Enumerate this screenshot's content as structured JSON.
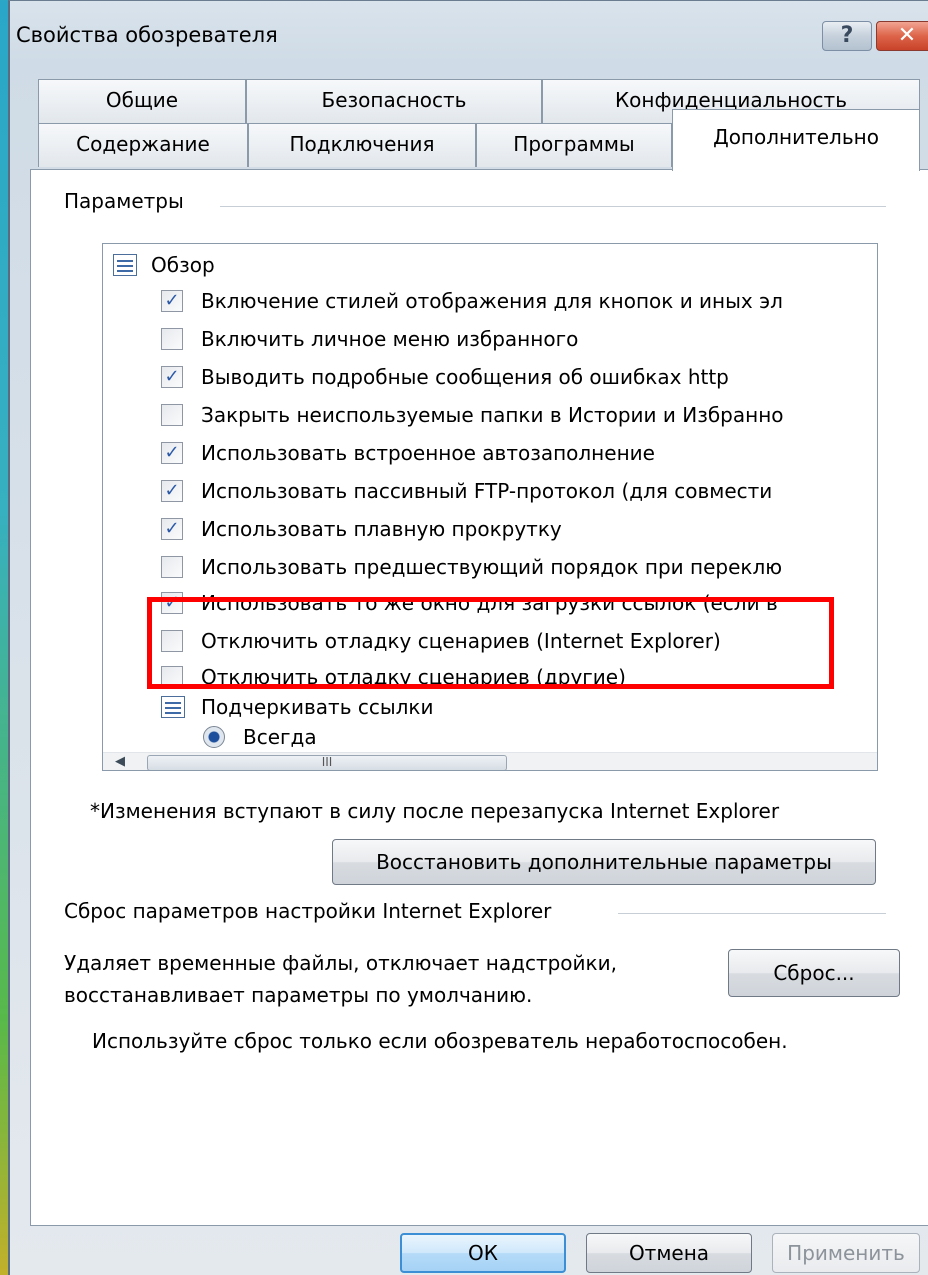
{
  "window": {
    "title": "Свойства обозревателя",
    "help_label": "?",
    "close_label": "✕"
  },
  "tabs": {
    "row1": [
      "Общие",
      "Безопасность",
      "Конфиденциальность"
    ],
    "row2": [
      "Содержание",
      "Подключения",
      "Программы",
      "Дополнительно"
    ],
    "active": "Дополнительно"
  },
  "settings": {
    "group_label": "Параметры",
    "items": [
      {
        "kind": "group",
        "label": "Обзор"
      },
      {
        "kind": "checkbox",
        "checked": true,
        "label": "Включение стилей отображения для кнопок и иных эл"
      },
      {
        "kind": "checkbox",
        "checked": false,
        "label": "Включить личное меню избранного"
      },
      {
        "kind": "checkbox",
        "checked": true,
        "label": "Выводить подробные сообщения об ошибках http"
      },
      {
        "kind": "checkbox",
        "checked": false,
        "label": "Закрыть неиспользуемые папки в Истории и Избранно"
      },
      {
        "kind": "checkbox",
        "checked": true,
        "label": "Использовать встроенное автозаполнение"
      },
      {
        "kind": "checkbox",
        "checked": true,
        "label": "Использовать пассивный FTP-протокол (для совмести"
      },
      {
        "kind": "checkbox",
        "checked": true,
        "label": "Использовать плавную прокрутку"
      },
      {
        "kind": "checkbox",
        "checked": false,
        "label": "Использовать предшествующий порядок при переклю"
      },
      {
        "kind": "checkbox",
        "checked": true,
        "label": "Использовать то же окно для загрузки ссылок (если в"
      },
      {
        "kind": "checkbox",
        "checked": false,
        "label": "Отключить отладку сценариев  (Internet Explorer)"
      },
      {
        "kind": "checkbox",
        "checked": false,
        "label": "Отключить отладку сценариев (другие)"
      },
      {
        "kind": "group",
        "label": "Подчеркивать ссылки"
      },
      {
        "kind": "radio",
        "checked": true,
        "label": "Всегда"
      }
    ],
    "hscroll_grip": "III",
    "restart_note": "*Изменения вступают в силу после перезапуска Internet Explorer",
    "restore_button": "Восстановить дополнительные параметры"
  },
  "reset": {
    "group_label": "Сброс параметров настройки Internet Explorer",
    "description_line1": "Удаляет временные файлы, отключает надстройки,",
    "description_line2": "восстанавливает параметры по умолчанию.",
    "button": "Сброс...",
    "warning": "Используйте сброс только если обозреватель неработоспособен."
  },
  "footer": {
    "ok": "ОК",
    "cancel": "Отмена",
    "apply": "Применить"
  },
  "colors": {
    "highlight": "#ff0000",
    "checkmark": "#2b59a8"
  }
}
